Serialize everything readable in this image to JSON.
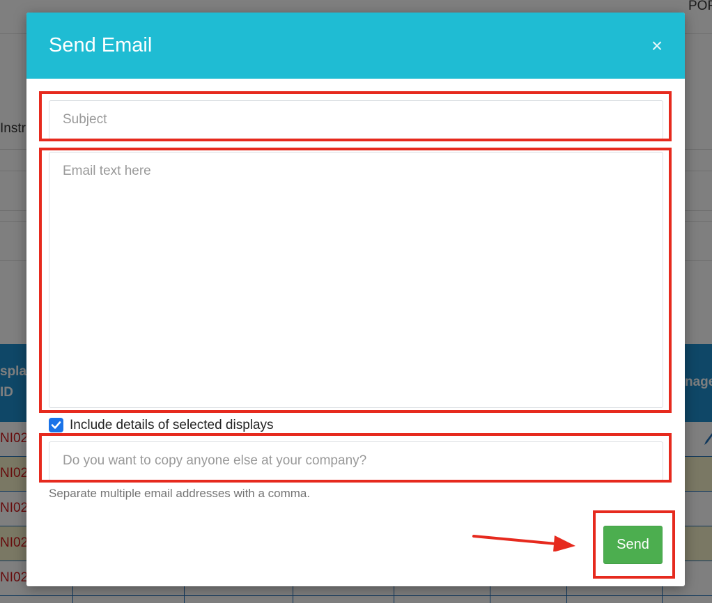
{
  "background": {
    "top_right_text": "POF",
    "left_label": "Instr",
    "table_header_col1_line1": "splay",
    "table_header_col1_line2": "ID",
    "table_header_right": "nage",
    "row_ids": [
      "NI02",
      "NI02",
      "NI02",
      "NI02",
      "NI02"
    ]
  },
  "modal": {
    "title": "Send Email",
    "close_glyph": "×",
    "subject_placeholder": "Subject",
    "body_placeholder": "Email text here",
    "include_details_label": "Include details of selected displays",
    "include_details_checked": true,
    "cc_placeholder": "Do you want to copy anyone else at your company?",
    "cc_help": "Separate multiple email addresses with a comma.",
    "send_label": "Send"
  },
  "colors": {
    "header": "#1fbcd3",
    "send_button": "#4cae4f",
    "annotation": "#e62a1e",
    "checkbox": "#1a73e8"
  },
  "icons": {
    "close": "close-icon",
    "checkbox": "checkmark-icon",
    "arrow": "arrow-right-icon"
  }
}
